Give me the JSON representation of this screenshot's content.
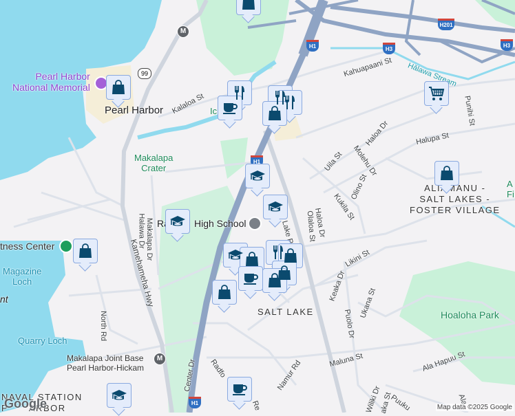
{
  "places": {
    "pearl_harbor_memorial": "Pearl Harbor\nNational Memorial",
    "pearl_harbor": "Pearl Harbor",
    "makalapa_crater": "Makalapa\nCrater",
    "high_school": "High School",
    "high_school_prefix": "Ra",
    "fitness_center": "tness Center",
    "magazine_loch": "Magazine\nLoch",
    "quarry_loch": "Quarry Loch",
    "makalapa_station": "Makalapa Joint Base\nPearl Harbor-Hickam",
    "naval_station": "NAVAL STATION\nP      ARBOR",
    "salt_lake": "SALT LAKE",
    "aliamanu": "ALIAMANU -\nSALT LAKES -\nFOSTER VILLAGE",
    "hoaloha_park": "Hoaloha Park",
    "halawa_stream": "Hālawa Stream",
    "ice_partial": "Ic     e H",
    "point_partial": "nt",
    "right_partial": "A\nFi"
  },
  "streets": {
    "kalaloa": "Kalaloa St",
    "kahuapaani": "Kahuapaani St",
    "halawa_dr": "Halawa Dr",
    "makalapa_dr": "Makalapa Dr",
    "kamehameha": "Kamehameha Hwy",
    "north_rd": "North Rd",
    "center_dr": "Center Dr",
    "radford": "Radfo",
    "namur": "Namur Rd",
    "re": "Re",
    "uila": "Uila St",
    "haloa_dr": "Haloa Dr",
    "molehu": "Molehu Dr",
    "olino": "Olino St",
    "kukila": "Kukila St",
    "olaloa": "Olaloa St",
    "haloa_dr2": "Haloa Dr",
    "lake_rd": "Lake R",
    "halupa": "Halupa St",
    "punihi": "Punihi St",
    "likini": "Likini St",
    "keaka": "Keaka Dr",
    "ukana": "Ukana St",
    "puolo": "Puolo Dr",
    "maluna": "Maluna St",
    "ala_hapuu": "Ala Hapuu St",
    "wiliki": "Wiliki Dr",
    "puuku": "Puuku",
    "aka": "aka St",
    "ala": "Ala"
  },
  "shields": {
    "h1": "H1",
    "h3": "H3",
    "h201": "H201",
    "r99": "99",
    "metro": "M"
  },
  "markers": [
    "shopping",
    "shopping",
    "restaurant",
    "cafe",
    "restaurant",
    "restaurant",
    "shopping",
    "shopping-cart",
    "school",
    "shopping",
    "school",
    "school",
    "shopping",
    "school",
    "shopping",
    "restaurant",
    "shopping",
    "shopping",
    "cafe",
    "shopping",
    "shopping",
    "cafe",
    "school"
  ],
  "colors": {
    "water": "#90daee",
    "park": "#c9f1d9",
    "highway": "#8fa4c4",
    "marker_icon": "#0b4a6e",
    "marker_bg": "#e4ecfb"
  },
  "footer": {
    "attribution": "Map data ©2025 Google",
    "logo": "Google"
  }
}
